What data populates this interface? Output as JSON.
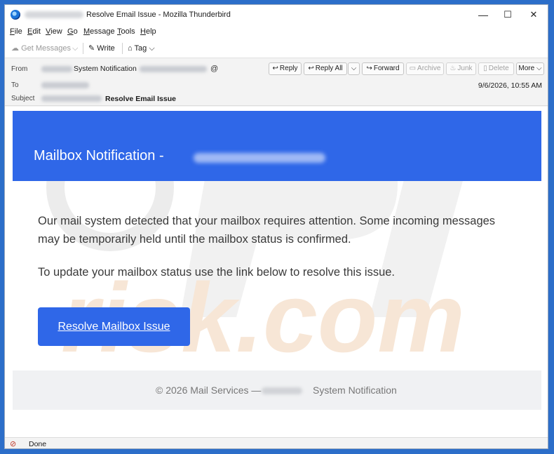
{
  "window": {
    "title": "Resolve Email Issue - Mozilla Thunderbird",
    "minimize": "—",
    "maximize": "☐",
    "close": "✕"
  },
  "menu": [
    "File",
    "Edit",
    "View",
    "Go",
    "Message",
    "Tools",
    "Help"
  ],
  "menu_underline": [
    "F",
    "E",
    "V",
    "G",
    "M",
    "T",
    "H"
  ],
  "toolbar": {
    "get_messages": "Get Messages",
    "write": "Write",
    "tag": "Tag"
  },
  "header": {
    "from_label": "From",
    "from_name": "System Notification",
    "to_label": "To",
    "subject_label": "Subject",
    "subject": "Resolve Email Issue",
    "datetime": "9/6/2026, 10:55 AM",
    "buttons": {
      "reply": "Reply",
      "reply_all": "Reply All",
      "forward": "Forward",
      "archive": "Archive",
      "junk": "Junk",
      "delete": "Delete",
      "more": "More"
    }
  },
  "email": {
    "banner_title": "Mailbox Notification -",
    "paragraph1": "Our mail system detected that your mailbox requires attention. Some incoming messages may be temporarily held until the mailbox status is confirmed.",
    "paragraph2": "To update your mailbox status use the link below to resolve this issue.",
    "cta": "Resolve Mailbox Issue",
    "footer_left": "© 2026 Mail Services —",
    "footer_right": "System Notification",
    "accent_color": "#2f67e8"
  },
  "watermark": "risk.com",
  "status": {
    "text": "Done"
  }
}
